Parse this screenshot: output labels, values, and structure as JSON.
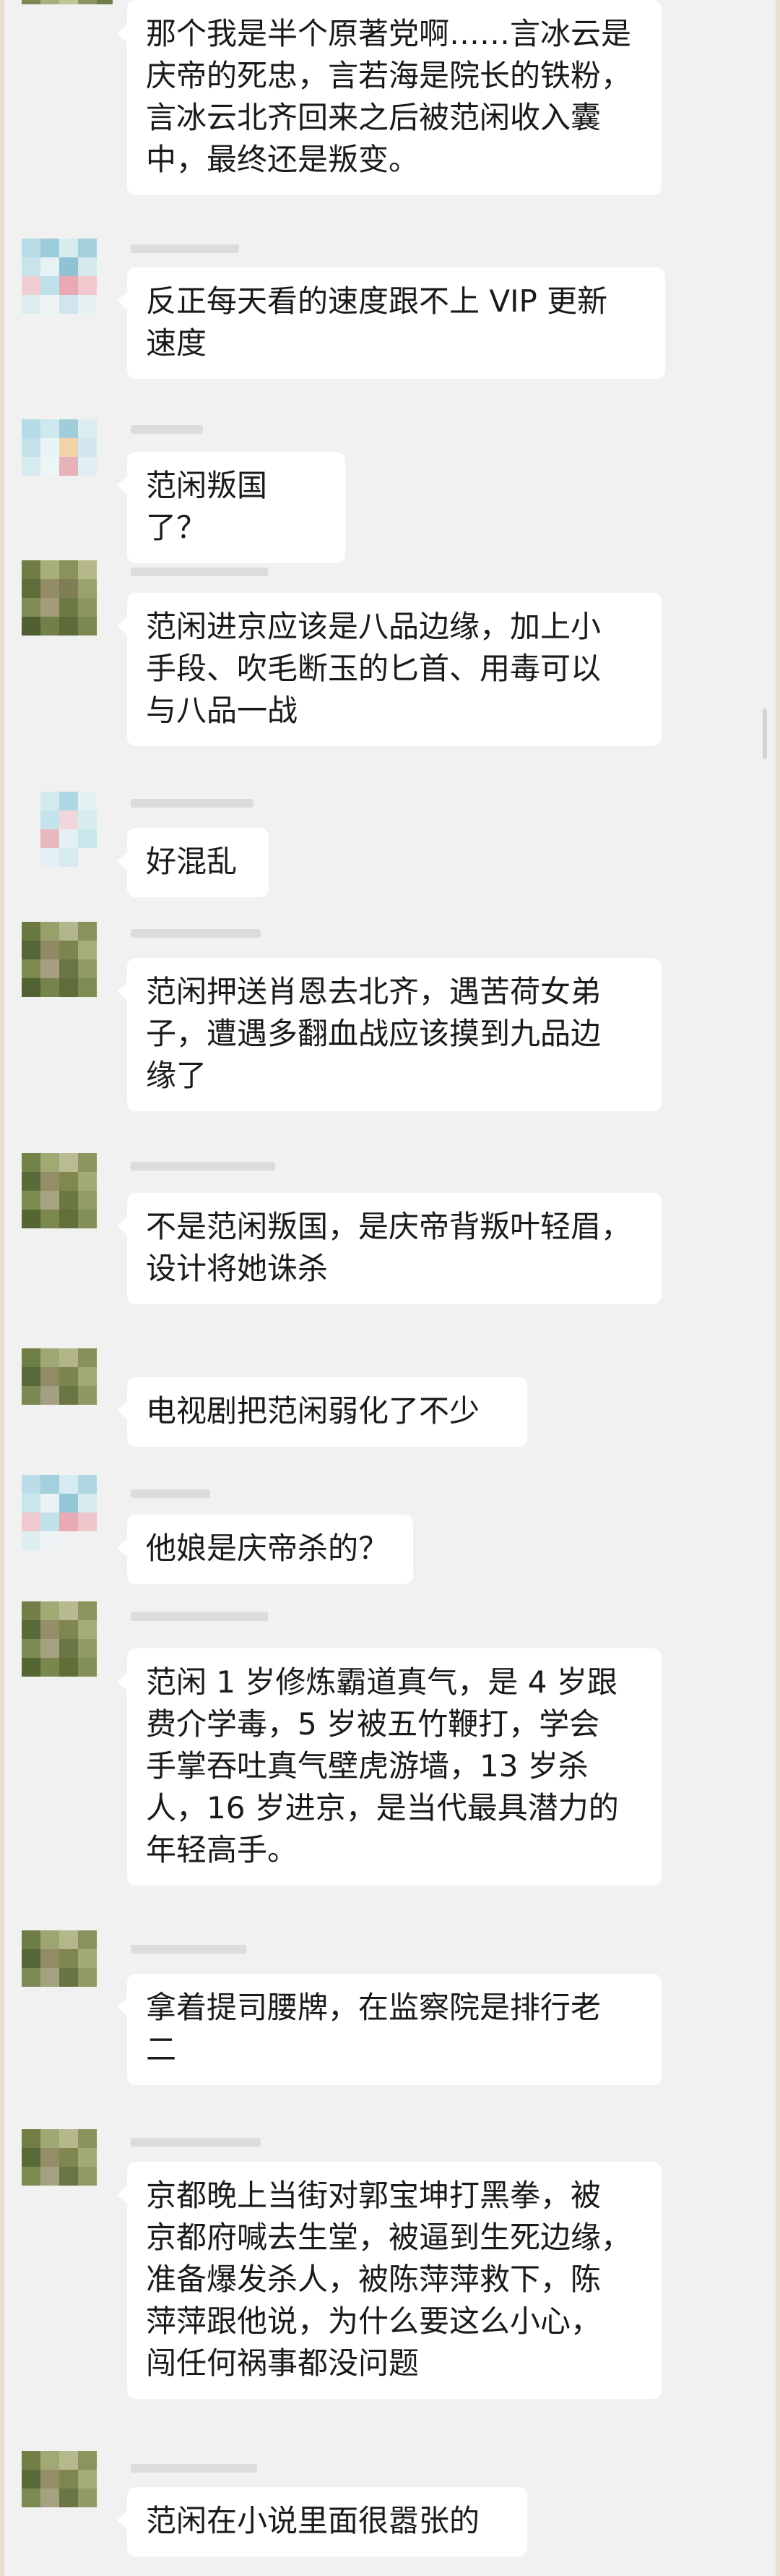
{
  "messages": [
    {
      "text": "那个我是半个原著党啊……言冰云是\n庆帝的死忠，言若海是院长的铁粉，\n言冰云北齐回来之后被范闲收入囊\n中，最终还是叛变。",
      "avatar": "green-avatar"
    },
    {
      "text": "反正每天看的速度跟不上 VIP 更新\n速度",
      "avatar": "blue-avatar"
    },
    {
      "text": "范闲叛国了？",
      "avatar": "blue-avatar"
    },
    {
      "text": "范闲进京应该是八品边缘，加上小\n手段、吹毛断玉的匕首、用毒可以\n与八品一战",
      "avatar": "green-avatar"
    },
    {
      "text": "好混乱",
      "avatar": "blue-avatar"
    },
    {
      "text": "范闲押送肖恩去北齐，遇苦荷女弟\n子，遭遇多翻血战应该摸到九品边\n缘了",
      "avatar": "green-avatar"
    },
    {
      "text": "不是范闲叛国，是庆帝背叛叶轻眉，\n设计将她诛杀",
      "avatar": "green-avatar"
    },
    {
      "text": "电视剧把范闲弱化了不少",
      "avatar": "green-avatar"
    },
    {
      "text": "他娘是庆帝杀的？",
      "avatar": "blue-avatar"
    },
    {
      "text": "范闲 1 岁修炼霸道真气，是 4 岁跟\n费介学毒，5 岁被五竹鞭打，学会\n手掌吞吐真气壁虎游墙，13 岁杀\n人，16 岁进京，是当代最具潜力的\n年轻高手。",
      "avatar": "green-avatar"
    },
    {
      "text": "拿着提司腰牌，在监察院是排行老\n二",
      "avatar": "green-avatar"
    },
    {
      "text": "京都晚上当街对郭宝坤打黑拳，被\n京都府喊去生堂，被逼到生死边缘，\n准备爆发杀人，被陈萍萍救下，陈\n萍萍跟他说，为什么要这么小心，\n闯任何祸事都没问题",
      "avatar": "green-avatar"
    },
    {
      "text": "范闲在小说里面很嚣张的",
      "avatar": "green-avatar"
    }
  ]
}
